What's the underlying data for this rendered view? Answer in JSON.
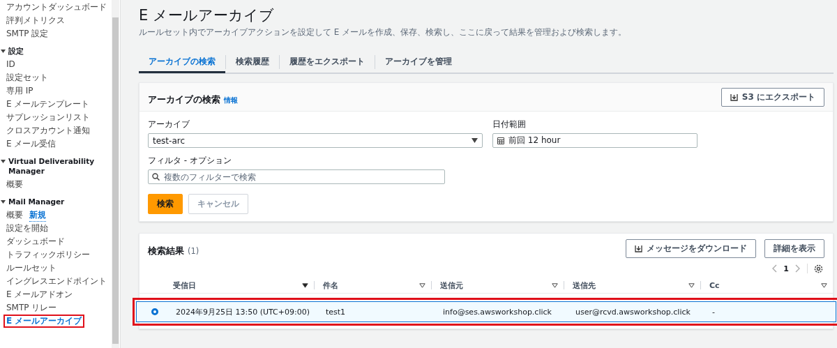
{
  "sidebar": {
    "groups": [
      {
        "items": [
          {
            "label": "アカウントダッシュボード",
            "selected": false,
            "highlighted": false
          },
          {
            "label": "評判メトリクス",
            "selected": false,
            "highlighted": false
          },
          {
            "label": "SMTP 設定",
            "selected": false,
            "highlighted": false
          }
        ]
      },
      {
        "title": "設定",
        "expanded": true,
        "items": [
          {
            "label": "ID",
            "selected": false,
            "highlighted": false
          },
          {
            "label": "設定セット",
            "selected": false,
            "highlighted": false
          },
          {
            "label": "専用 IP",
            "selected": false,
            "highlighted": false
          },
          {
            "label": "E メールテンプレート",
            "selected": false,
            "highlighted": false
          },
          {
            "label": "サプレッションリスト",
            "selected": false,
            "highlighted": false
          },
          {
            "label": "クロスアカウント通知",
            "selected": false,
            "highlighted": false
          },
          {
            "label": "E メール受信",
            "selected": false,
            "highlighted": false
          }
        ]
      },
      {
        "title": "Virtual Deliverability Manager",
        "expanded": true,
        "items": [
          {
            "label": "概要",
            "selected": false,
            "highlighted": false
          }
        ]
      },
      {
        "title": "Mail Manager",
        "expanded": true,
        "items": [
          {
            "label": "概要",
            "badge": "新規",
            "selected": false,
            "highlighted": false
          },
          {
            "label": "設定を開始",
            "selected": false,
            "highlighted": false
          },
          {
            "label": "ダッシュボード",
            "selected": false,
            "highlighted": false
          },
          {
            "label": "トラフィックポリシー",
            "selected": false,
            "highlighted": false
          },
          {
            "label": "ルールセット",
            "selected": false,
            "highlighted": false
          },
          {
            "label": "イングレスエンドポイント",
            "selected": false,
            "highlighted": false
          },
          {
            "label": "E メールアドオン",
            "selected": false,
            "highlighted": false
          },
          {
            "label": "SMTP リレー",
            "selected": false,
            "highlighted": false
          },
          {
            "label": "E メールアーカイブ",
            "selected": true,
            "highlighted": true
          }
        ]
      }
    ]
  },
  "page": {
    "title": "E メールアーカイブ",
    "description": "ルールセット内でアーカイブアクションを設定して E メールを作成、保存、検索し、ここに戻って結果を管理および検索します。"
  },
  "tabs": [
    {
      "label": "アーカイブの検索",
      "selected": true
    },
    {
      "label": "検索履歴",
      "selected": false
    },
    {
      "label": "履歴をエクスポート",
      "selected": false
    },
    {
      "label": "アーカイブを管理",
      "selected": false
    }
  ],
  "search_panel": {
    "title": "アーカイブの検索",
    "info": "情報",
    "export_button": "S3 にエクスポート",
    "archive_label": "アーカイブ",
    "archive_value": "test-arc",
    "date_label": "日付範囲",
    "date_value": "前回 12 hour",
    "filter_label": "フィルタ - オプション",
    "filter_placeholder": "複数のフィルターで検索",
    "search_button": "検索",
    "cancel_button": "キャンセル"
  },
  "results_panel": {
    "title": "検索結果",
    "count": "(1)",
    "download_button": "メッセージをダウンロード",
    "details_button": "詳細を表示",
    "page": "1",
    "columns": [
      {
        "label": "受信日",
        "sorted": true
      },
      {
        "label": "件名",
        "sorted": false
      },
      {
        "label": "送信元",
        "sorted": false
      },
      {
        "label": "送信先",
        "sorted": false
      },
      {
        "label": "Cc",
        "sorted": false
      }
    ],
    "rows": [
      {
        "selected": true,
        "highlighted": true,
        "cells": [
          "2024年9月25日 13:50 (UTC+09:00)",
          "test1",
          "info@ses.awsworkshop.click",
          "user@rcvd.awsworkshop.click",
          "-"
        ]
      }
    ]
  }
}
